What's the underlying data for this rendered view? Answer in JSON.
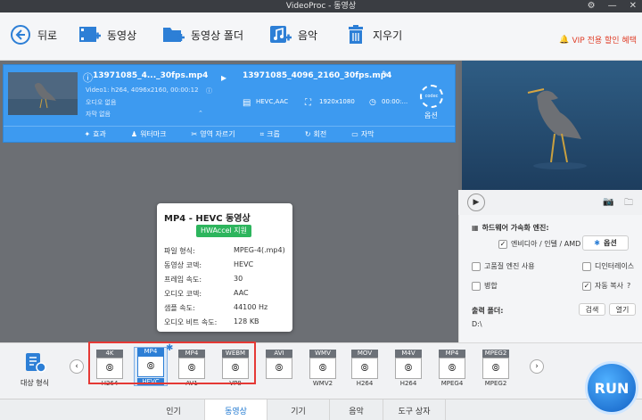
{
  "window": {
    "title": "VideoProc - 동영상"
  },
  "toolbar": {
    "back_label": "뒤로",
    "video_label": "동영상",
    "video_folder_label": "동영상 폴더",
    "music_label": "음악",
    "clear_label": "지우기",
    "vip_label": "VIP 전용 할인 혜택"
  },
  "task": {
    "source_name": "13971085_4..._30fps.mp4",
    "video_info": "Video1: h264, 4096x2160, 00:00:12",
    "audio_info": "오디오 없음",
    "subtitle_info": "자막 없음",
    "output_name": "13971085_4096_2160_30fps.mp4",
    "output_codec": "HEVC,AAC",
    "output_res": "1920x1080",
    "output_time": "00:00:...",
    "codec_label": "codec",
    "options_label": "옵션",
    "edit": {
      "effects": "효과",
      "watermark": "워터마크",
      "cut": "영역 자르기",
      "crop": "크롭",
      "rotate": "회전",
      "subtitle": "자막"
    }
  },
  "right": {
    "hw_title": "하드웨어 가속화 엔진:",
    "hw_option": "엔비디아 / 인텔 / AMD",
    "options_btn": "옵션",
    "hq_engine": "고품질 엔진 사용",
    "deinterlace": "디인터레이스",
    "merge": "병합",
    "autocopy": "자동 복사",
    "output_folder_label": "출력 폴더:",
    "browse_btn": "검색",
    "open_btn": "열기",
    "output_path": "D:\\"
  },
  "tooltip": {
    "title": "MP4 - HEVC 동영상",
    "badge": "HWAccel 지원",
    "rows": [
      {
        "k": "파일 형식:",
        "v": "MPEG-4(.mp4)"
      },
      {
        "k": "동영상 코덱:",
        "v": "HEVC"
      },
      {
        "k": "프레임 속도:",
        "v": "30"
      },
      {
        "k": "오디오 코덱:",
        "v": "AAC"
      },
      {
        "k": "샘플 속도:",
        "v": "44100 Hz"
      },
      {
        "k": "오디오 비트 속도:",
        "v": "128 KB"
      }
    ]
  },
  "formats": {
    "target_label": "대상 형식",
    "items": [
      {
        "tag": "4K",
        "sub": "H264"
      },
      {
        "tag": "MP4",
        "sub": "HEVC"
      },
      {
        "tag": "MP4",
        "sub": "AV1"
      },
      {
        "tag": "WEBM",
        "sub": "VP8"
      },
      {
        "tag": "AVI",
        "sub": ""
      },
      {
        "tag": "WMV",
        "sub": "WMV2"
      },
      {
        "tag": "MOV",
        "sub": "H264"
      },
      {
        "tag": "M4V",
        "sub": "H264"
      },
      {
        "tag": "MP4",
        "sub": "MPEG4"
      },
      {
        "tag": "MPEG2",
        "sub": "MPEG2"
      }
    ]
  },
  "tabs": [
    "인기",
    "동영상",
    "기기",
    "음악",
    "도구 상자"
  ],
  "run_label": "RUN"
}
